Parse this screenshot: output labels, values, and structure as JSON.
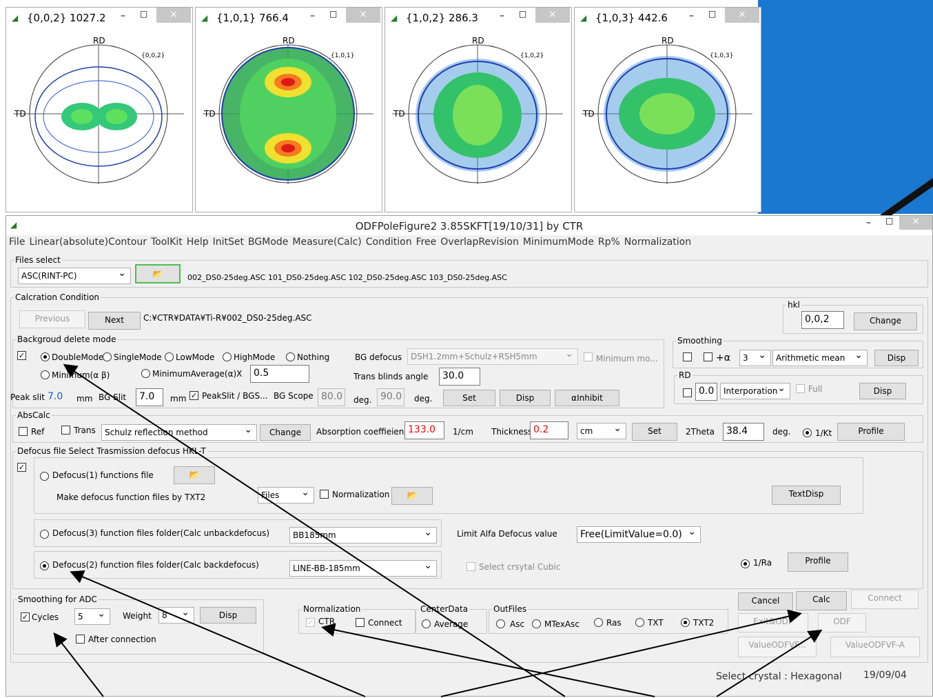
{
  "pole_figures": [
    {
      "title": "{0,0,2} 1027.2",
      "hkl": "{0,0,2}"
    },
    {
      "title": "{1,0,1} 766.4",
      "hkl": "{1,0,1}"
    },
    {
      "title": "{1,0,2} 286.3",
      "hkl": "{1,0,2}"
    },
    {
      "title": "{1,0,3} 442.6",
      "hkl": "{1,0,3}"
    }
  ],
  "pf_axis": {
    "rd": "RD",
    "td": "TD"
  },
  "window": {
    "title": "ODFPoleFigure2 3.85SKFT[19/10/31] by CTR",
    "min": "–",
    "max": "□",
    "close": "×"
  },
  "menu": [
    "File",
    "Linear(absolute)Contour",
    "ToolKit",
    "Help",
    "InitSet",
    "BGMode",
    "Measure(Calc)",
    "Condition",
    "Free",
    "OverlapRevision",
    "MinimumMode",
    "Rp%",
    "Normalization"
  ],
  "files_select": {
    "label": "Files select",
    "format": "ASC(RINT-PC)",
    "files": "002_DS0-25deg.ASC 101_DS0-25deg.ASC 102_DS0-25deg.ASC 103_DS0-25deg.ASC"
  },
  "calc": {
    "label": "Calcration Condition",
    "previous": "Previous",
    "next": "Next",
    "path": "C:¥CTR¥DATA¥Ti-R¥002_DS0-25deg.ASC",
    "hkl_label": "hkl",
    "hkl": "0,0,2",
    "change": "Change"
  },
  "bg": {
    "label": "Backgroud delete mode",
    "double": "DoubleMode",
    "single": "SingleMode",
    "low": "LowMode",
    "high": "HighMode",
    "nothing": "Nothing",
    "bg_defocus_label": "BG defocus",
    "bg_defocus": "DSH1.2mm+Schulz+RSH5mm",
    "minimum_mode": "Minimum mo...",
    "minimum_ab": "Minimum(α β)",
    "minimum_avg": "MinimumAverage(α)X",
    "minimum_avg_val": "0.5",
    "trans_label": "Trans blinds angle",
    "trans_val": "30.0",
    "peak_slit": "Peak slit",
    "peak_val": "7.0",
    "mm": "mm",
    "bg_slit": "BG Slit",
    "bg_slit_val": "7.0",
    "peakslit_chk": "PeakSlit / BGS...",
    "bg_scope": "BG Scope",
    "bg_scope_val": "80.0",
    "deg": "deg.",
    "deg_val": "90.0",
    "set": "Set",
    "disp": "Disp",
    "inhibit": "αInhibit"
  },
  "smoothing": {
    "label": "Smoothing",
    "plus_a": "+α",
    "num": "3",
    "method": "Arithmetic mean",
    "disp": "Disp"
  },
  "rd": {
    "label": "RD",
    "val": "0.0",
    "interp": "Interporation",
    "full": "Full",
    "disp": "Disp"
  },
  "abscalc": {
    "label": "AbsCalc",
    "ref": "Ref",
    "trans": "Trans",
    "method": "Schulz reflection method",
    "change": "Change",
    "abs_label": "Absorption coeffieien",
    "abs_val": "133.0",
    "unit": "1/cm",
    "thick_label": "Thickness",
    "thick_val": "0.2",
    "thick_unit": "cm",
    "set": "Set",
    "theta_label": "2Theta",
    "theta_val": "38.4",
    "deg": "deg.",
    "kt": "1/Kt",
    "profile": "Profile"
  },
  "defocus": {
    "label": "Defocus file Select Trasmission defocus HKL-T",
    "d1": "Defocus(1) functions file",
    "make": "Make defocus function files by TXT2",
    "files": "Files",
    "normalization": "Normalization",
    "textdisp": "TextDisp",
    "d3": "Defocus(3) function files folder(Calc unbackdefocus)",
    "d3_sel": "BB185mm",
    "limit_label": "Limit Alfa Defocus value",
    "limit_sel": "Free(LimitValue=0.0)",
    "d2": "Defocus(2) function files folder(Calc backdefocus)",
    "d2_sel": "LINE-BB-185mm",
    "cubic": "Select crsytal Cubic",
    "ra": "1/Ra",
    "profile": "Profile"
  },
  "adc": {
    "label": "Smoothing for ADC",
    "cycles": "Cycles",
    "cycles_val": "5",
    "weight": "Weight",
    "weight_val": "8",
    "disp": "Disp",
    "after": "After connection"
  },
  "norm": {
    "label": "Normalization",
    "ctr": "CTR",
    "connect": "Connect"
  },
  "center": {
    "label": "CenterData",
    "average": "Average"
  },
  "outfiles": {
    "label": "OutFiles",
    "asc": "Asc",
    "mtex": "MTexAsc",
    "ras": "Ras",
    "txt": "TXT",
    "txt2": "TXT2"
  },
  "actions": {
    "cancel": "Cancel",
    "calc": "Calc",
    "connect": "Connect",
    "exit_odf": "Exit&ODF",
    "odf": "ODF",
    "vodf": "ValueODFVF...",
    "vodfa": "ValueODFVF-A"
  },
  "status": {
    "crystal": "Select crystal : Hexagonal",
    "date": "19/09/04"
  }
}
